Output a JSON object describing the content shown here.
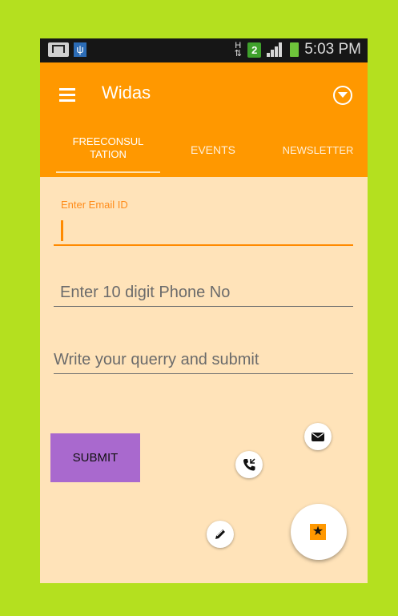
{
  "statusbar": {
    "h_indicator": "H",
    "sim_number": "2",
    "time": "5:03 PM"
  },
  "appbar": {
    "title": "Widas",
    "menu_icon": "hamburger-icon",
    "action_icon": "dropdown-circle-icon",
    "background": "#ff9800"
  },
  "tabs": [
    {
      "label": "FREECONSUL\nTATION",
      "line1": "FREECONSUL",
      "line2": "TATION",
      "selected": true
    },
    {
      "label": "EVENTS",
      "selected": false
    },
    {
      "label": "NEWSLETTER",
      "selected": false
    }
  ],
  "form": {
    "email_label": "Enter Email ID",
    "email_value": "",
    "phone_placeholder": "Enter 10 digit Phone No",
    "query_placeholder": "Write your querry and submit",
    "submit_label": "SUBMIT"
  },
  "fabs": {
    "mail_icon": "mail-icon",
    "call_icon": "call-icon",
    "edit_icon": "pencil-icon",
    "main_icon": "star-icon"
  },
  "colors": {
    "accent": "#ff9800",
    "background": "#ffe3b9",
    "frame": "#b4e01f",
    "submit": "#a969ce"
  }
}
